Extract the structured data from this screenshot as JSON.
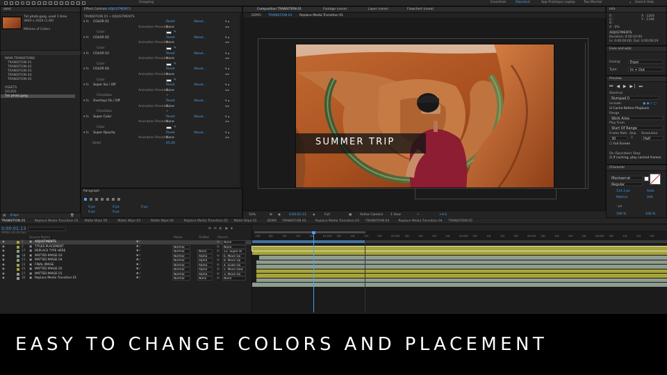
{
  "workspace": {
    "tool_label": "Snapping",
    "items": [
      "Essentials",
      "Standard",
      "App Prototype Laptop",
      "Two Monitor"
    ],
    "active": "Standard",
    "search": "Search Help"
  },
  "project": {
    "tab": "oject",
    "file_name": "Txt photo.jpeg",
    "file_used": ", used 1 time",
    "file_size": "3840 x 2026 (1.00)",
    "file_colors": "Millions of Colors",
    "items": [
      "MAIN TRANSITIONS",
      "TRANSITION 01",
      "TRANSITION 02",
      "TRANSITION 03",
      "TRANSITION 04",
      "TRANSITION 05",
      "ASSETS",
      "SOLIDS",
      "Txt photo.jpeg"
    ],
    "footer": "8 bpc"
  },
  "effect_controls": {
    "tab": "Effect Controls",
    "tab_target": "ADJUSTMENTS",
    "breadcrumb": "TRANSITION 01 • ADJUSTMENTS",
    "rows": [
      {
        "indent": 1,
        "label": "COLOR 01",
        "reset": "Reset",
        "about": "About..."
      },
      {
        "indent": 2,
        "label": "",
        "mid": "Animation Presets:",
        "value": "None"
      },
      {
        "indent": 3,
        "label": "Color"
      },
      {
        "indent": 1,
        "label": "COLOR 02",
        "reset": "Reset",
        "about": "About..."
      },
      {
        "indent": 2,
        "label": "",
        "mid": "Animation Presets:",
        "value": "None"
      },
      {
        "indent": 3,
        "label": "Color"
      },
      {
        "indent": 1,
        "label": "COLOR 03",
        "reset": "Reset",
        "about": "About..."
      },
      {
        "indent": 2,
        "label": "",
        "mid": "Animation Presets:",
        "value": "None"
      },
      {
        "indent": 3,
        "label": "Color"
      },
      {
        "indent": 1,
        "label": "COLOR 04",
        "reset": "Reset",
        "about": "About..."
      },
      {
        "indent": 2,
        "label": "",
        "mid": "Animation Presets:",
        "value": "None"
      },
      {
        "indent": 3,
        "label": "Color"
      },
      {
        "indent": 1,
        "label": "Super Six / Off",
        "reset": "Reset",
        "about": "About..."
      },
      {
        "indent": 2,
        "label": "",
        "mid": "Animation Presets:",
        "value": "None"
      },
      {
        "indent": 3,
        "label": "Checkbox"
      },
      {
        "indent": 1,
        "label": "Overlays On / Off",
        "reset": "Reset",
        "about": "About..."
      },
      {
        "indent": 2,
        "label": "",
        "mid": "Animation Presets:",
        "value": "None"
      },
      {
        "indent": 3,
        "label": "Checkbox"
      },
      {
        "indent": 1,
        "label": "Super Color",
        "reset": "Reset",
        "about": "About..."
      },
      {
        "indent": 2,
        "label": "",
        "mid": "Animation Presets:",
        "value": "None"
      },
      {
        "indent": 3,
        "label": "Color"
      },
      {
        "indent": 1,
        "label": "Super Opacity",
        "reset": "Reset",
        "about": "About..."
      },
      {
        "indent": 2,
        "label": "",
        "mid": "Animation Presets:",
        "value": "None"
      },
      {
        "indent": 2,
        "label": "Slider",
        "value": "65.00"
      }
    ]
  },
  "paragraph": {
    "tab": "Paragraph",
    "v1": "0 px",
    "v2": "0 px",
    "v3": "0 px",
    "v4": "0 px",
    "v5": "0 px"
  },
  "composition": {
    "tabs": [
      "Composition TRANSITION 01",
      "Footage (none)",
      "Layer (none)",
      "Flowchart (none)"
    ],
    "crumbs": [
      "DEMO",
      "TRANSITION 01",
      "Replace Media Transition 01"
    ],
    "overlay_text": "SUMMER TRIP",
    "zoom": "50%",
    "timecode": "0:00:01:13",
    "resolution": "Full",
    "camera": "Active Camera",
    "view": "1 View",
    "exposure": "+0.0"
  },
  "info": {
    "tab": "Info",
    "r": "R :",
    "g": "G :",
    "b": "B :",
    "a": "A : 0%",
    "x": "X : 1204",
    "y": "Y : 1168",
    "name": "ADJUSTMENTS",
    "duration": "Duration: 0:00:10:00",
    "inout": "In: 0:00:00:00, Out: 0:00:09:29"
  },
  "ease": {
    "tab": "Ease and wizz",
    "easing_label": "Easing:",
    "easing": "Expo",
    "type_label": "Type:",
    "type": "In + Out"
  },
  "preview": {
    "tab": "Preview",
    "shortcut_label": "Shortcut",
    "shortcut": "Numpad 0",
    "include": "Include:",
    "cache": "Cache Before Playback",
    "range_label": "Range",
    "range": "Work Area",
    "play_from_label": "Play From",
    "play_from": "Start Of Range",
    "fps_label": "Frame Rate",
    "skip_label": "Skip",
    "res_label": "Resolution",
    "fps": "30",
    "skip": "0",
    "res": "Half",
    "full_screen": "Full Screen",
    "stop_label": "On (Spacebar) Stop:",
    "stop_opt": "If caching, play cached frames"
  },
  "character": {
    "tab": "Character",
    "font": "Montserrat",
    "style": "Regular",
    "size": "114.3 px",
    "leading": "Auto",
    "kerning": "Metrics",
    "tracking": "200",
    "scale_h": "100 %",
    "scale_v": "100 %",
    "baseline": "- px"
  },
  "timeline": {
    "tabs": [
      "TRANSITION 01",
      "Replace Media Transition 01",
      "Matte Wipe 05",
      "Matte Wipe 03",
      "Matte Wipe 04",
      "Replace Media Transition 02",
      "Matte Wipe 01",
      "DEMO",
      "TRANSITION 03",
      "Replace Media Transition 03",
      "TRANSITION 04",
      "Replace Media Transition 04",
      "TRANSITION 05"
    ],
    "timecode": "0:00:01:13",
    "timecode_sub": "00043 (30.00 fps)",
    "col_source": "Source Name",
    "col_mode": "Mode",
    "col_trkmat": "TrkMat",
    "col_parent": "Parent",
    "ruler": [
      ":00f",
      "05f",
      "10f",
      "15f",
      "20f",
      "01:00f",
      "05f",
      "10f",
      "15f",
      "20f",
      "02:00f",
      "05f",
      "10f",
      "15f",
      "20f",
      "03:00f",
      "05f",
      "10f",
      "15f",
      "20f",
      "04:00f",
      "05f",
      "10f",
      "15f",
      "20f",
      "05:00f",
      "05f",
      "10f",
      "15f",
      "20f"
    ],
    "layers": [
      {
        "num": "1",
        "name": "ADJUSTMENTS",
        "mode": "",
        "trk": "",
        "parent": "None",
        "color": "#a7a437",
        "sel": true
      },
      {
        "num": "2",
        "name": "TITLES PLACEMENT",
        "mode": "Normal",
        "trk": "",
        "parent": "None",
        "color": "#a7a437",
        "sel": false
      },
      {
        "num": "17",
        "name": "REPLACE TYPE HERE",
        "mode": "Normal",
        "trk": "None",
        "parent": "13. Super Bl",
        "color": "#8e9c8e",
        "sel": false
      },
      {
        "num": "18",
        "name": "MATTED IMAGE 03",
        "mode": "Normal",
        "trk": "Alpha",
        "parent": "6. Move Up",
        "color": "#8e9c8e",
        "sel": false
      },
      {
        "num": "21",
        "name": "MATTED IMAGE 04",
        "mode": "Normal",
        "trk": "Alpha",
        "parent": "8. Move Up",
        "color": "#8e9c8e",
        "sel": false
      },
      {
        "num": "23",
        "name": "FINAL IMAGE",
        "mode": "Normal",
        "trk": "Alpha",
        "parent": "4. Scale Up",
        "color": "#a7a437",
        "sel": false
      },
      {
        "num": "25",
        "name": "MATTED IMAGE 05",
        "mode": "Normal",
        "trk": "Alpha",
        "parent": "5. Move Dow",
        "color": "#a7a437",
        "sel": false
      },
      {
        "num": "27",
        "name": "MATTED IMAGE 01",
        "mode": "Normal",
        "trk": "Alpha",
        "parent": "3. Move Up",
        "color": "#8e9c8e",
        "sel": false
      },
      {
        "num": "30",
        "name": "Replace Media Transition 01",
        "mode": "Normal",
        "trk": "None",
        "parent": "None",
        "color": "#8e9c8e",
        "sel": false
      }
    ]
  },
  "caption": "EASY TO CHANGE COLORS AND PLACEMENT",
  "colors": {
    "accent": "#4aa3f0",
    "work_area": "#a7a437",
    "layer_sage": "#8e9c8e",
    "playhead": "#4aa3f0"
  }
}
